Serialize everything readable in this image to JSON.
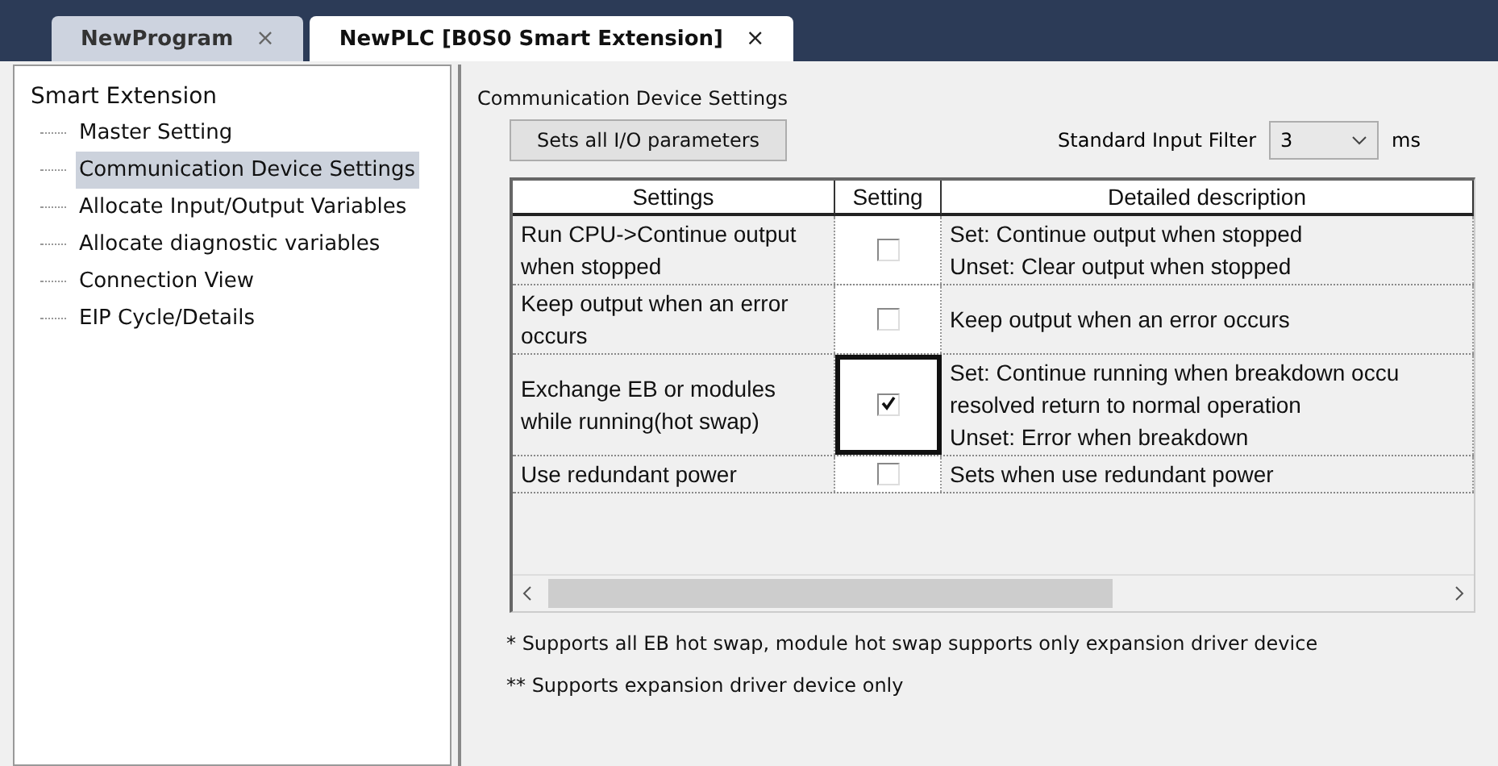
{
  "tabs": [
    {
      "label": "NewProgram",
      "close": "×",
      "selected": false
    },
    {
      "label": "NewPLC [B0S0 Smart Extension]",
      "close": "×",
      "selected": true
    }
  ],
  "tree": {
    "label": "Smart Extension",
    "children": [
      {
        "label": "Master Setting",
        "selected": false
      },
      {
        "label": "Communication Device Settings",
        "selected": true
      },
      {
        "label": "Allocate Input/Output Variables",
        "selected": false
      },
      {
        "label": "Allocate diagnostic variables",
        "selected": false
      },
      {
        "label": "Connection View",
        "selected": false
      },
      {
        "label": "EIP Cycle/Details",
        "selected": false
      }
    ]
  },
  "group": {
    "title": "Communication Device Settings",
    "button": "Sets all I/O parameters",
    "filter": {
      "label": "Standard Input Filter",
      "value": "3",
      "unit": "ms"
    },
    "table": {
      "columns": [
        "Settings",
        "Setting",
        "Detailed description"
      ],
      "rows": [
        {
          "setting": "Run CPU->Continue output when stopped",
          "checked": false,
          "focused": false,
          "description": [
            "Set: Continue output when stopped",
            "Unset: Clear output when stopped"
          ]
        },
        {
          "setting": "Keep output when an error occurs",
          "checked": false,
          "focused": false,
          "description": [
            "Keep output when an error occurs"
          ]
        },
        {
          "setting": "Exchange EB or modules while running(hot swap)",
          "checked": true,
          "focused": true,
          "description": [
            "Set: Continue running when breakdown occu",
            "resolved return to normal operation",
            "Unset: Error when breakdown"
          ]
        },
        {
          "setting": "Use redundant power",
          "checked": false,
          "focused": false,
          "description": [
            "Sets when use redundant power"
          ]
        }
      ]
    },
    "notes": [
      "* Supports all EB hot swap, module hot swap supports only expansion driver device",
      "** Supports expansion driver device only"
    ]
  }
}
